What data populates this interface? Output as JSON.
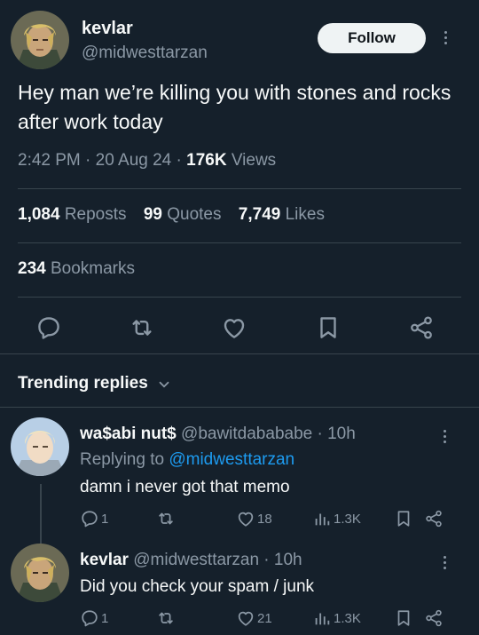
{
  "tweet": {
    "author_name": "kevlar",
    "author_handle": "@midwesttarzan",
    "follow_label": "Follow",
    "text": "Hey man we’re killing you with stones and rocks after work today",
    "time": "2:42 PM",
    "date": "20 Aug 24",
    "views_count": "176K",
    "views_label": "Views",
    "sep": "·"
  },
  "stats": {
    "reposts_count": "1,084",
    "reposts_label": "Reposts",
    "quotes_count": "99",
    "quotes_label": "Quotes",
    "likes_count": "7,749",
    "likes_label": "Likes",
    "bookmarks_count": "234",
    "bookmarks_label": "Bookmarks"
  },
  "actions": [
    "reply-icon",
    "repost-icon",
    "like-icon",
    "bookmark-icon",
    "share-icon"
  ],
  "trending": {
    "label": "Trending replies"
  },
  "replies": [
    {
      "name": "wa$abi nut$",
      "handle": "@bawitdabababe",
      "time": "· 10h",
      "replying_prefix": "Replying to",
      "replying_handle": "@midwesttarzan",
      "text": "damn i never got that memo",
      "reply_count": "1",
      "repost_count": "",
      "like_count": "18",
      "view_count": "1.3K"
    },
    {
      "name": "kevlar",
      "handle": "@midwesttarzan",
      "time": "· 10h",
      "text": "Did you check your spam / junk",
      "reply_count": "1",
      "repost_count": "",
      "like_count": "21",
      "view_count": "1.3K"
    }
  ],
  "colors": {
    "background": "#15202b",
    "text": "#f7f9f9",
    "muted": "#8b98a5",
    "link": "#1d9bf0",
    "divider": "#38444d",
    "follow_bg": "#eff3f4"
  }
}
